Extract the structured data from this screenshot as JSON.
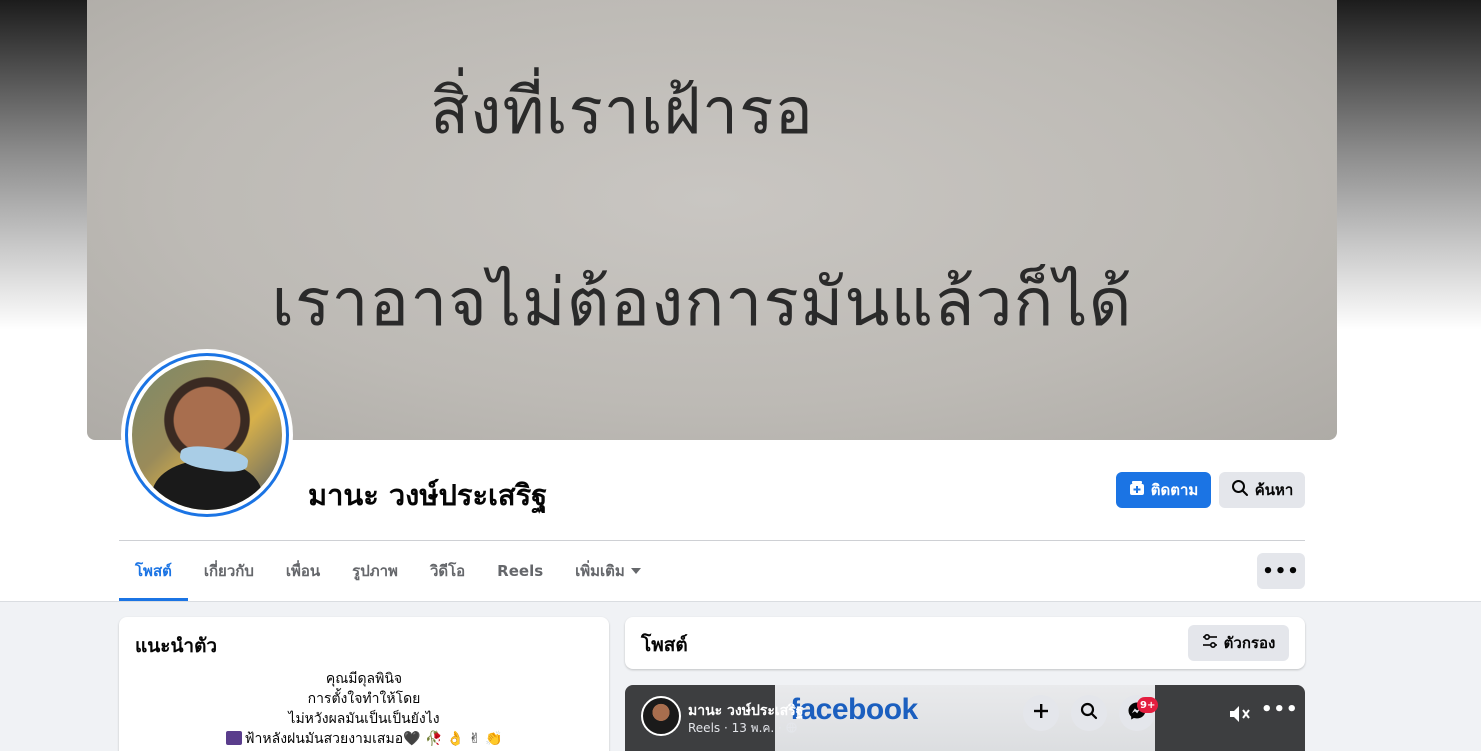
{
  "cover": {
    "line1": "สิ่งที่เราเฝ้ารอ",
    "line2": "เราอาจไม่ต้องการมันแล้วก็ได้"
  },
  "profile": {
    "name": "มานะ วงษ์ประเสริฐ",
    "follow_label": "ติดตาม",
    "search_label": "ค้นหา"
  },
  "tabs": [
    {
      "label": "โพสต์"
    },
    {
      "label": "เกี่ยวกับ"
    },
    {
      "label": "เพื่อน"
    },
    {
      "label": "รูปภาพ"
    },
    {
      "label": "วิดีโอ"
    },
    {
      "label": "Reels"
    },
    {
      "label": "เพิ่มเติม"
    }
  ],
  "intro": {
    "title": "แนะนำตัว",
    "bio_lines": [
      "คุณมีดุลพินิจ",
      "การตั้งใจทำให้โดย",
      "ไม่หวังผลมันเป็นเป็นยังไง",
      "ฟ้าหลังฝนมันสวยงามเสมอ🖤 🥀 👌 ✌ 👏"
    ]
  },
  "posts": {
    "title": "โพสต์",
    "filter_label": "ตัวกรอง"
  },
  "reel": {
    "author": "มานะ วงษ์ประเสริฐ",
    "meta": "Reels · 13 พ.ค. ·",
    "logo_text": "facebook",
    "badge": "9+"
  },
  "colors": {
    "accent": "#1b74e4",
    "button_gray": "#e4e6eb",
    "page_bg": "#f0f2f5"
  }
}
